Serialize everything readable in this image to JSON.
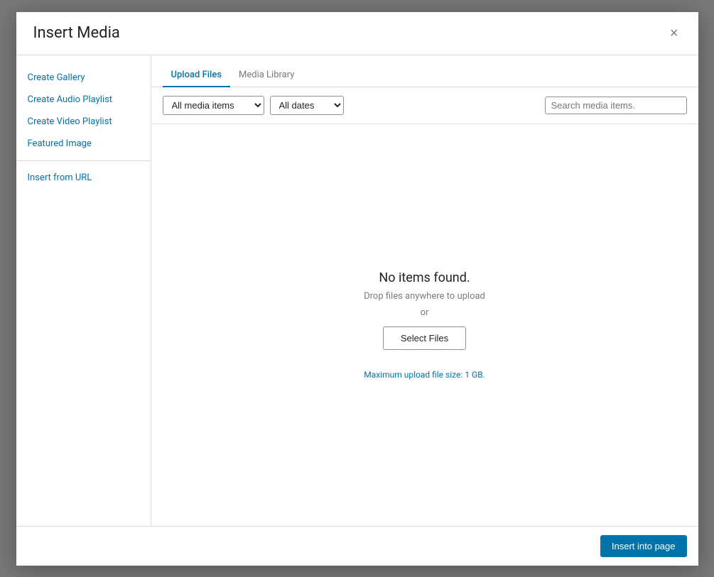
{
  "modal": {
    "title": "Insert Media",
    "close_label": "×"
  },
  "sidebar": {
    "heading": "Insert Media",
    "items": [
      {
        "id": "create-gallery",
        "label": "Create Gallery"
      },
      {
        "id": "create-audio-playlist",
        "label": "Create Audio Playlist"
      },
      {
        "id": "create-video-playlist",
        "label": "Create Video Playlist"
      },
      {
        "id": "featured-image",
        "label": "Featured Image"
      }
    ],
    "secondary_items": [
      {
        "id": "insert-from-url",
        "label": "Insert from URL"
      }
    ]
  },
  "tabs": [
    {
      "id": "upload-files",
      "label": "Upload Files",
      "active": true
    },
    {
      "id": "media-library",
      "label": "Media Library",
      "active": false
    }
  ],
  "filters": {
    "media_items_label": "All media items",
    "dates_label": "All dates",
    "search_placeholder": "Search media items."
  },
  "upload": {
    "no_items_text": "No items found.",
    "drop_text": "Drop files anywhere to upload",
    "or_text": "or",
    "select_files_label": "Select Files",
    "max_upload_text": "Maximum upload file size: ",
    "max_upload_size": "1 GB",
    "max_upload_suffix": "."
  },
  "footer": {
    "insert_button_label": "Insert into page"
  }
}
